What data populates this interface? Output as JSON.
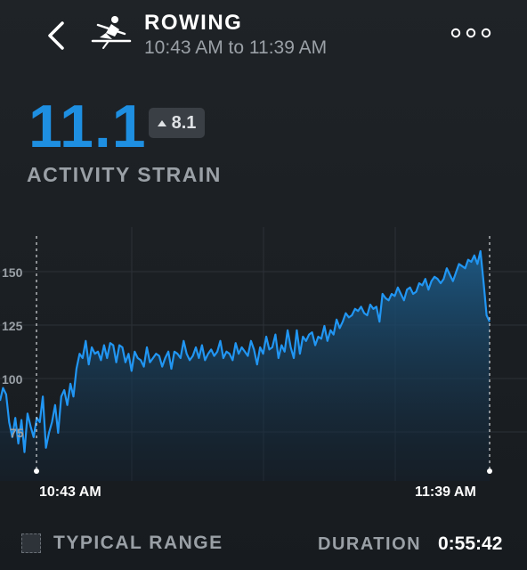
{
  "header": {
    "title": "ROWING",
    "time_range": "10:43 AM to 11:39 AM",
    "back_icon": "chevron-left-icon",
    "activity_icon": "rowing-icon",
    "more_icon": "more-horizontal-icon"
  },
  "strain": {
    "value": "11.1",
    "delta": "8.1",
    "label": "ACTIVITY STRAIN",
    "accent_color": "#1e8fe1"
  },
  "chart_data": {
    "type": "area",
    "ylabel": "",
    "y_ticks": [
      "150",
      "125",
      "100",
      "75"
    ],
    "ylim": [
      50,
      162
    ],
    "x_start_label": "10:43 AM",
    "x_end_label": "11:39 AM",
    "grid": true,
    "line_color": "#2196f3",
    "series": [
      {
        "values": [
          90,
          96,
          93,
          80,
          73,
          82,
          70,
          81,
          66,
          84,
          78,
          73,
          82,
          80,
          92,
          68,
          75,
          80,
          88,
          75,
          92,
          95,
          88,
          98,
          92,
          105,
          112,
          110,
          118,
          107,
          115,
          112,
          113,
          109,
          116,
          110,
          117,
          116,
          108,
          116,
          115,
          108,
          112,
          104,
          113,
          110,
          109,
          106,
          115,
          108,
          110,
          112,
          111,
          106,
          110,
          113,
          105,
          113,
          112,
          110,
          118,
          112,
          109,
          111,
          115,
          110,
          116,
          109,
          112,
          114,
          111,
          113,
          118,
          110,
          113,
          112,
          109,
          117,
          112,
          115,
          113,
          111,
          118,
          114,
          107,
          115,
          112,
          120,
          114,
          115,
          121,
          110,
          116,
          113,
          123,
          115,
          110,
          123,
          112,
          120,
          118,
          121,
          122,
          116,
          120,
          119,
          125,
          118,
          123,
          121,
          128,
          124,
          127,
          131,
          129,
          130,
          133,
          132,
          134,
          131,
          130,
          135,
          133,
          134,
          127,
          140,
          138,
          137,
          140,
          139,
          143,
          140,
          137,
          142,
          143,
          140,
          141,
          145,
          144,
          147,
          142,
          146,
          148,
          147,
          145,
          147,
          152,
          149,
          146,
          150,
          154,
          153,
          152,
          156,
          155,
          158,
          154,
          160,
          146,
          130,
          127
        ]
      }
    ]
  },
  "legend": {
    "typical_range_label": "TYPICAL RANGE",
    "duration_label": "DURATION",
    "duration_value": "0:55:42"
  }
}
